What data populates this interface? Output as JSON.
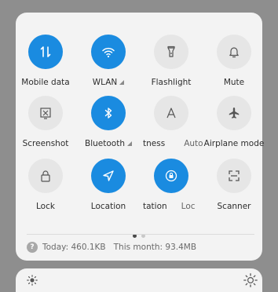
{
  "tiles": [
    {
      "id": "mobile-data",
      "label": "Mobile data",
      "on": true,
      "icon": "arrows-icon"
    },
    {
      "id": "wlan",
      "label": "WLAN",
      "on": true,
      "icon": "wifi-icon",
      "signal": true
    },
    {
      "id": "flashlight",
      "label": "Flashlight",
      "on": false,
      "icon": "flashlight-icon"
    },
    {
      "id": "mute",
      "label": "Mute",
      "on": false,
      "icon": "bell-icon"
    },
    {
      "id": "screenshot",
      "label": "Screenshot",
      "on": false,
      "icon": "screenshot-icon"
    },
    {
      "id": "bluetooth",
      "label": "Bluetooth",
      "on": true,
      "icon": "bluetooth-icon",
      "signal": true
    },
    {
      "id": "brightness-auto",
      "label": "tness",
      "on": false,
      "icon": "auto-brightness-icon",
      "second_label": "Auto"
    },
    {
      "id": "airplane",
      "label": "Airplane mode",
      "on": false,
      "icon": "airplane-icon"
    },
    {
      "id": "lock",
      "label": "Lock",
      "on": false,
      "icon": "lock-icon"
    },
    {
      "id": "location",
      "label": "Location",
      "on": true,
      "icon": "location-icon"
    },
    {
      "id": "rotation",
      "label": "tation",
      "on": true,
      "icon": "rotation-lock-icon",
      "second_label": "Loc"
    },
    {
      "id": "scanner",
      "label": "Scanner",
      "on": false,
      "icon": "scanner-icon"
    }
  ],
  "usage": {
    "today": "Today: 460.1KB",
    "month": "This month: 93.4MB"
  },
  "page_indicator": {
    "current": 1,
    "total": 2
  },
  "colors": {
    "accent": "#1a8be0",
    "tile_off": "#e6e6e6"
  }
}
